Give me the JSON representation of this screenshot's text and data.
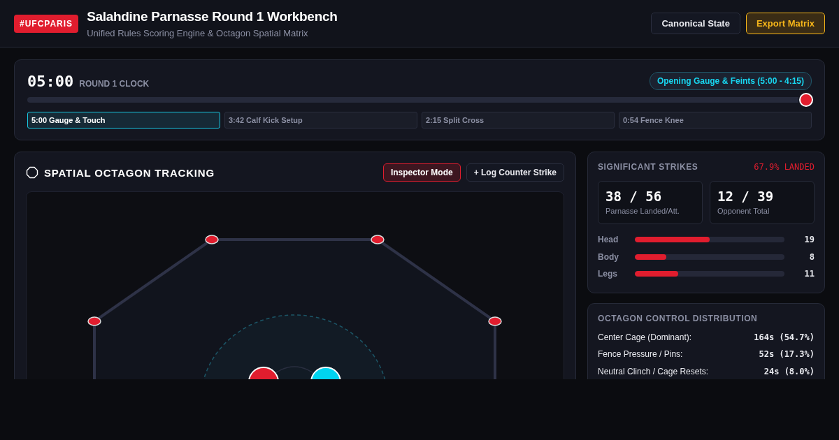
{
  "header": {
    "badge": "#UFCPARIS",
    "title": "Salahdine Parnasse Round 1 Workbench",
    "subtitle": "Unified Rules Scoring Engine & Octagon Spatial Matrix",
    "buttons": [
      {
        "label": "Canonical State",
        "kind": "plain"
      },
      {
        "label": "Export Matrix",
        "kind": "accent"
      }
    ]
  },
  "clock": {
    "time": "05:00",
    "label": "ROUND 1 CLOCK",
    "phase": "Opening Gauge & Feints (5:00 - 4:15)",
    "level": 1,
    "segments": [
      {
        "label": "5:00 Gauge & Touch",
        "selected": true
      },
      {
        "label": "3:42 Calf Kick Setup",
        "selected": false
      },
      {
        "label": "2:15 Split Cross",
        "selected": false
      },
      {
        "label": "0:54 Fence Knee",
        "selected": false
      }
    ]
  },
  "tracking": {
    "title": "SPATIAL OCTAGON TRACKING",
    "buttons": [
      {
        "label": "Inspector Mode",
        "kind": "danger"
      },
      {
        "label": "+ Log Counter Strike",
        "kind": "plain"
      }
    ],
    "fighters": [
      {
        "color": "#e11d2e"
      },
      {
        "color": "#00d4f0"
      }
    ]
  },
  "strikes": {
    "title": "SIGNIFICANT STRIKES",
    "accuracy": "67.9% LANDED",
    "totals": [
      {
        "value": "38 / 56",
        "label": "Parnasse Landed/Att."
      },
      {
        "value": "12 / 39",
        "label": "Opponent Total"
      }
    ],
    "targets": [
      {
        "name": "Head",
        "level": 0.5,
        "count": "19"
      },
      {
        "name": "Body",
        "level": 0.21,
        "count": "8"
      },
      {
        "name": "Legs",
        "level": 0.29,
        "count": "11"
      }
    ]
  },
  "control": {
    "title": "OCTAGON CONTROL DISTRIBUTION",
    "rows": [
      {
        "name": "Center Cage (Dominant):",
        "value": "164s (54.7%)"
      },
      {
        "name": "Fence Pressure / Pins:",
        "value": "52s (17.3%)"
      },
      {
        "name": "Neutral Clinch / Cage Resets:",
        "value": "24s (8.0%)"
      }
    ]
  }
}
